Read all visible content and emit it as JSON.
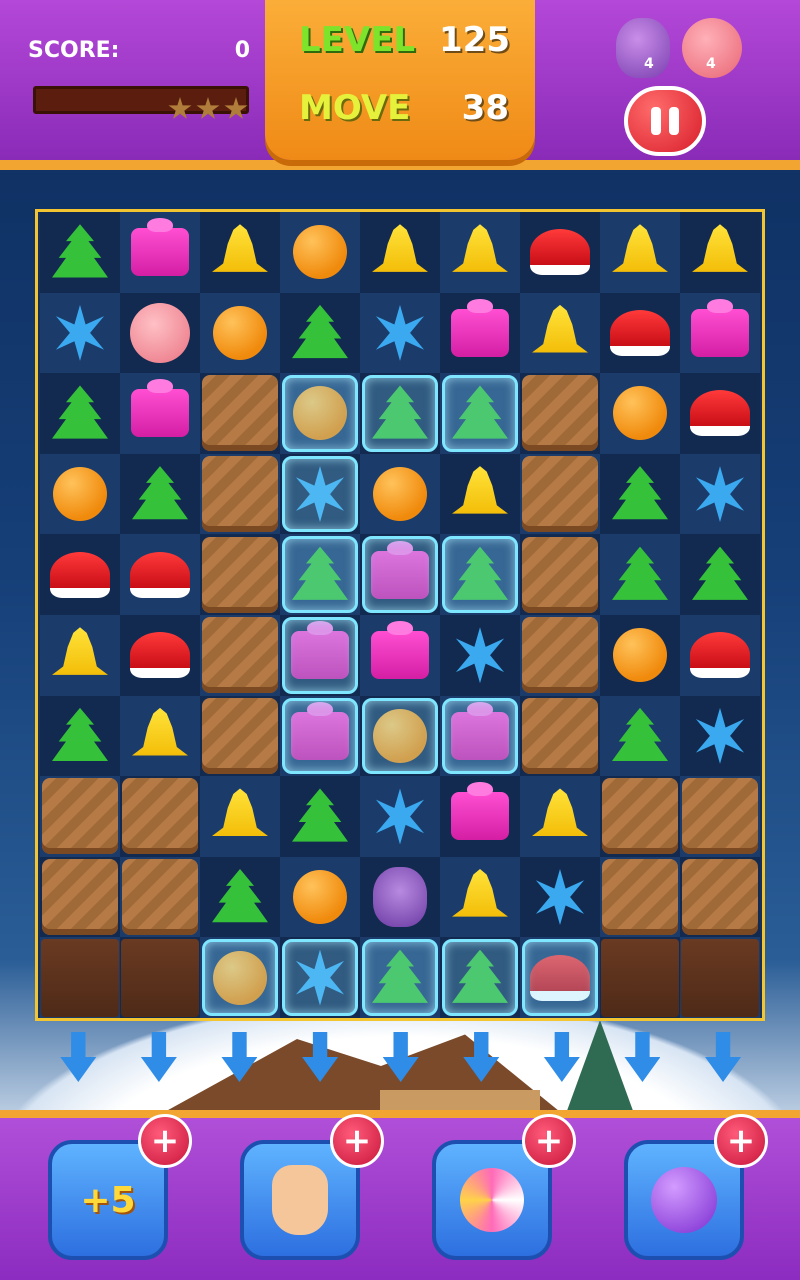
{
  "hud": {
    "score_label": "SCORE:",
    "score_value": "0",
    "score_progress": 0,
    "stars_total": 3,
    "level_label": "LEVEL",
    "level_value": "125",
    "move_label": "MOVE",
    "move_value": "38",
    "goals": [
      {
        "icon": "owl-icon",
        "count": "4"
      },
      {
        "icon": "pig-icon",
        "count": "4"
      }
    ]
  },
  "board": {
    "cols": 9,
    "rows": 10,
    "cells": [
      [
        "tree",
        "gift",
        "bell",
        "orange",
        "bell",
        "bell",
        "hat",
        "bell",
        "bell"
      ],
      [
        "snowflake",
        "pig",
        "orange",
        "tree",
        "snowflake",
        "gift",
        "bell",
        "hat",
        "gift"
      ],
      [
        "tree",
        "gift",
        "wood",
        "ice-orange",
        "ice-tree",
        "ice-tree",
        "wood",
        "orange",
        "hat"
      ],
      [
        "orange",
        "tree",
        "wood",
        "ice-snowflake",
        "orange",
        "bell",
        "wood",
        "tree",
        "snowflake"
      ],
      [
        "hat",
        "hat",
        "wood",
        "ice-tree",
        "ice-gift",
        "ice-tree",
        "wood",
        "tree",
        "tree"
      ],
      [
        "bell",
        "hat",
        "wood",
        "ice-gift",
        "gift",
        "snowflake",
        "wood",
        "orange",
        "hat"
      ],
      [
        "tree",
        "bell",
        "wood",
        "ice-gift",
        "ice-orange",
        "ice-gift",
        "wood",
        "tree",
        "snowflake"
      ],
      [
        "wood",
        "wood",
        "bell",
        "tree",
        "snowflake",
        "gift",
        "bell",
        "wood",
        "wood"
      ],
      [
        "wood",
        "wood",
        "tree",
        "orange",
        "owl",
        "bell",
        "snowflake",
        "wood",
        "wood"
      ],
      [
        "choco",
        "choco",
        "ice-orange",
        "ice-snowflake",
        "ice-tree",
        "ice-tree",
        "ice-hat",
        "choco",
        "choco"
      ]
    ]
  },
  "boosters": [
    {
      "name": "extra-moves",
      "label": "+5"
    },
    {
      "name": "hand",
      "label": ""
    },
    {
      "name": "lollipop",
      "label": ""
    },
    {
      "name": "bomb",
      "label": ""
    }
  ],
  "plus_symbol": "+"
}
